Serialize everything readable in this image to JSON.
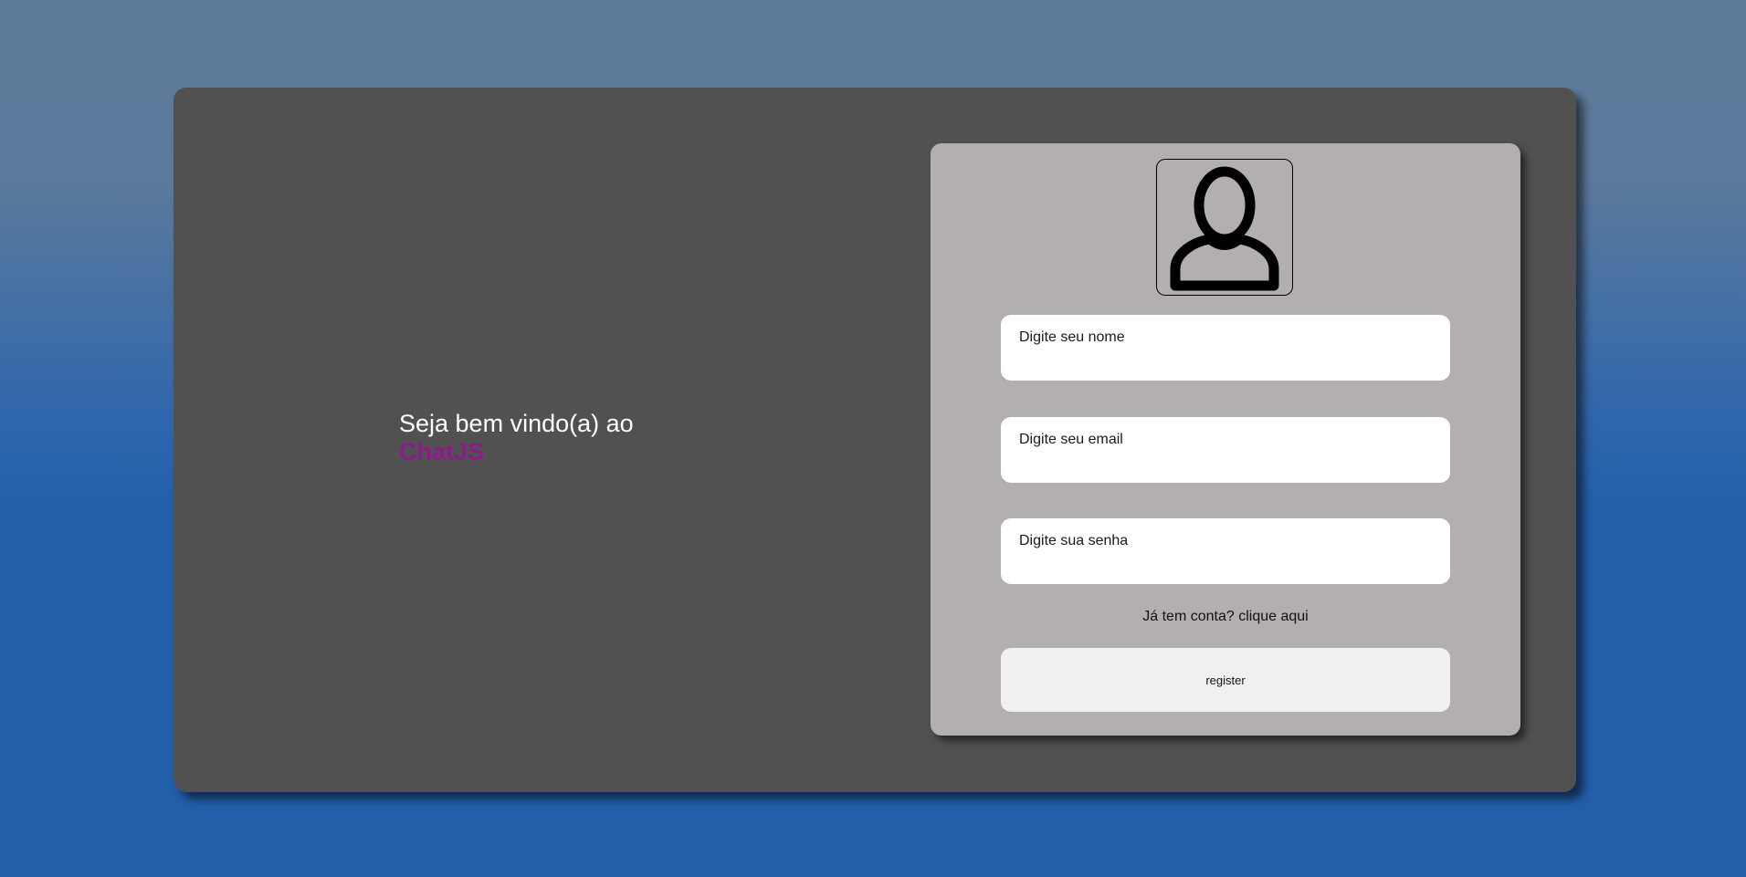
{
  "welcome": {
    "line": "Seja bem vindo(a) ao",
    "brand": "ChatJS",
    "brand_color": "#8e1a8e"
  },
  "form": {
    "avatar_icon": "user-icon",
    "name_placeholder": "Digite seu nome",
    "email_placeholder": "Digite seu email",
    "password_placeholder": "Digite sua senha",
    "login_prompt": "Já tem conta?",
    "login_link": "clique aqui",
    "register_label": "register"
  }
}
